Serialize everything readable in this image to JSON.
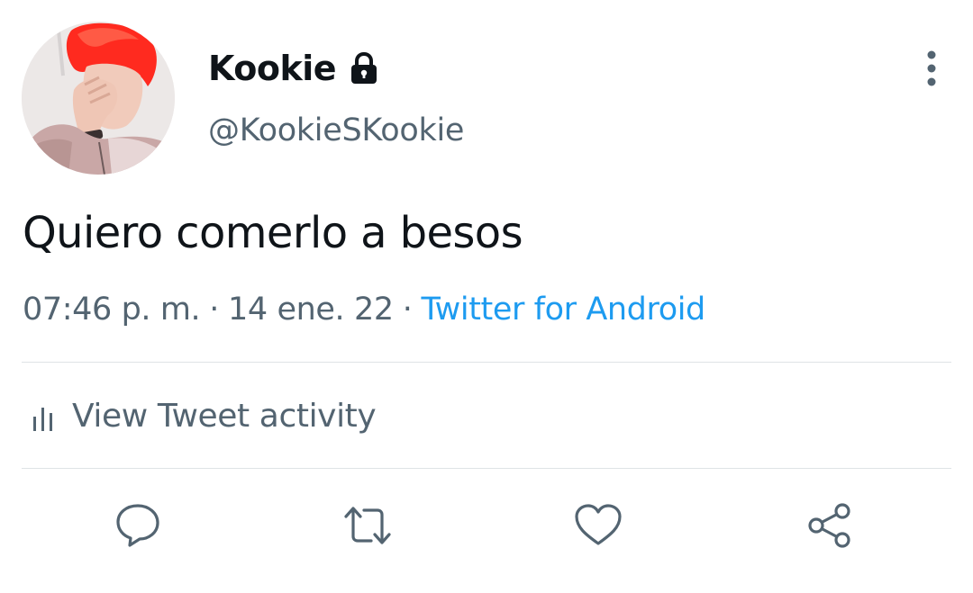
{
  "tweet": {
    "display_name": "Kookie",
    "handle": "@KookieSKookie",
    "text": "Quiero comerlo a besos",
    "time": "07:46 p. m.",
    "separator": "·",
    "date": "14 ene. 22",
    "source": "Twitter for Android",
    "protected_icon": "lock-icon",
    "avatar": "profile-photo"
  },
  "activity": {
    "label": "View Tweet activity",
    "icon": "bar-chart-icon"
  },
  "actions": [
    {
      "name": "reply",
      "icon": "reply-icon"
    },
    {
      "name": "retweet",
      "icon": "retweet-icon"
    },
    {
      "name": "like",
      "icon": "heart-icon"
    },
    {
      "name": "share",
      "icon": "share-icon"
    }
  ],
  "colors": {
    "text": "#0f1419",
    "secondary": "#536471",
    "link": "#1d9bf0",
    "divider": "#dfe3e6"
  }
}
